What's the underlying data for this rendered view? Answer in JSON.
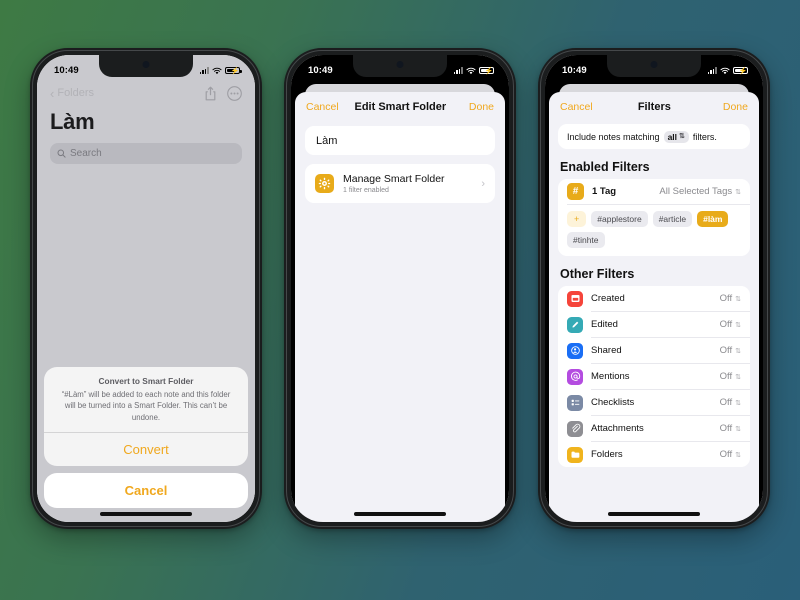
{
  "status_bar": {
    "time": "10:49",
    "battery_state": "charging"
  },
  "phone1": {
    "nav": {
      "back_label": "Folders",
      "share_icon": "share-icon",
      "more_icon": "ellipsis-circle-icon"
    },
    "title": "Làm",
    "search_placeholder": "Search",
    "action_sheet": {
      "title": "Convert to Smart Folder",
      "message": "“#Làm” will be added to each note and this folder will be turned into a Smart Folder. This can’t be undone.",
      "confirm_label": "Convert",
      "cancel_label": "Cancel"
    }
  },
  "phone2": {
    "nav": {
      "cancel_label": "Cancel",
      "title": "Edit Smart Folder",
      "done_label": "Done"
    },
    "name_field_value": "Làm",
    "manage_row": {
      "icon": "gear-icon",
      "title": "Manage Smart Folder",
      "subtitle": "1 filter enabled",
      "chevron": "chevron-right-icon"
    }
  },
  "phone3": {
    "nav": {
      "cancel_label": "Cancel",
      "title": "Filters",
      "done_label": "Done"
    },
    "match_rule": {
      "prefix": "Include notes matching",
      "value": "all",
      "suffix": "filters."
    },
    "enabled_section_title": "Enabled Filters",
    "tag_row": {
      "icon": "hash-icon",
      "label": "1 Tag",
      "value": "All Selected Tags"
    },
    "tags": [
      {
        "label": "+",
        "type": "add"
      },
      {
        "label": "#applestore",
        "type": "normal"
      },
      {
        "label": "#article",
        "type": "normal"
      },
      {
        "label": "#làm",
        "type": "selected"
      },
      {
        "label": "#tinhte",
        "type": "normal"
      }
    ],
    "other_section_title": "Other Filters",
    "other_filters": [
      {
        "label": "Created",
        "value": "Off",
        "icon": "calendar-icon",
        "color": "#f5443a"
      },
      {
        "label": "Edited",
        "value": "Off",
        "icon": "pencil-icon",
        "color": "#35aab5"
      },
      {
        "label": "Shared",
        "value": "Off",
        "icon": "person-shared-icon",
        "color": "#1a6ef5"
      },
      {
        "label": "Mentions",
        "value": "Off",
        "icon": "at-icon",
        "color": "#b44ce0"
      },
      {
        "label": "Checklists",
        "value": "Off",
        "icon": "checklist-icon",
        "color": "#7b8aa5"
      },
      {
        "label": "Attachments",
        "value": "Off",
        "icon": "paperclip-icon",
        "color": "#8e8e93"
      },
      {
        "label": "Folders",
        "value": "Off",
        "icon": "folder-icon",
        "color": "#f0b41e"
      }
    ]
  },
  "theme": {
    "accent": "#f0a81e",
    "tag_yellow": "#e8ab1a",
    "bg_from": "#3e7a44",
    "bg_to": "#2a5f79"
  }
}
